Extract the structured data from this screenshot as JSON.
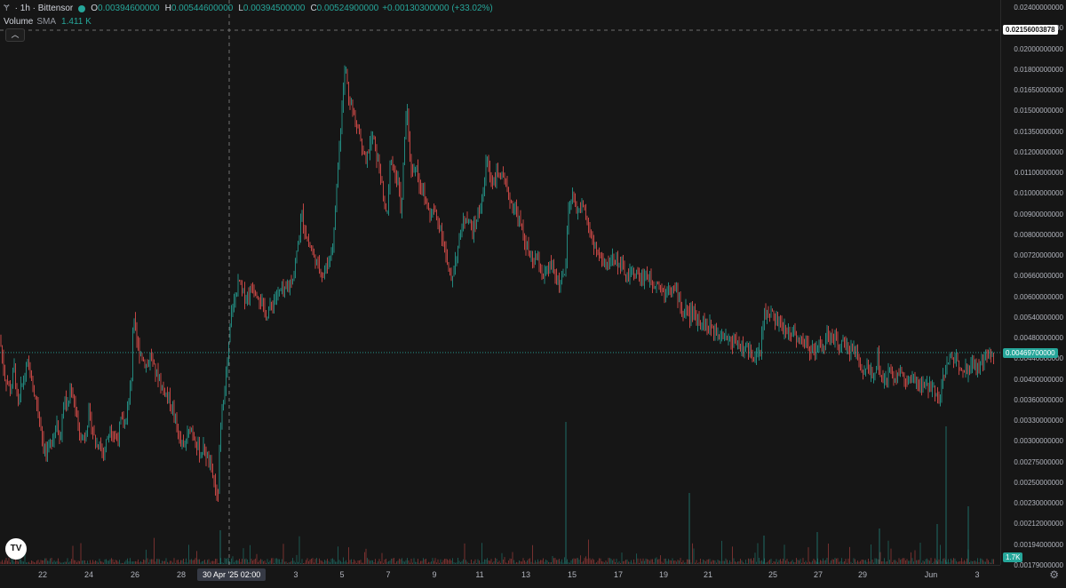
{
  "symbol": {
    "glyph": "Ɏ",
    "title": "· 1h · Bittensor",
    "ohlc": {
      "o_key": "O",
      "o": "0.00394600000",
      "h_key": "H",
      "h": "0.00544600000",
      "l_key": "L",
      "l": "0.00394500000",
      "c_key": "C",
      "c": "0.00524900000",
      "change": "+0.00130300000 (+33.02%)"
    }
  },
  "volume": {
    "label": "Volume",
    "sma_label": "SMA",
    "value": "1.411 K"
  },
  "collapse_icon": "chevron-up-icon",
  "logo_text": "TV",
  "price_axis": {
    "labels": [
      "0.02400000000",
      "0.02200000000",
      "0.02000000000",
      "0.01800000000",
      "0.01650000000",
      "0.01500000000",
      "0.01350000000",
      "0.01200000000",
      "0.01100000000",
      "0.01000000000",
      "0.00900000000",
      "0.00800000000",
      "0.00720000000",
      "0.00660000000",
      "0.00600000000",
      "0.00540000000",
      "0.00480000000",
      "0.00440000000",
      "0.00400000000",
      "0.00360000000",
      "0.00330000000",
      "0.00300000000",
      "0.00275000000",
      "0.00250000000",
      "0.00230000000",
      "0.00212000000",
      "0.00194000000",
      "0.00179000000"
    ],
    "crosshair_price": "0.02156003878",
    "last_price": "0.00469700000",
    "volume_tag": "1.7K"
  },
  "time_axis": {
    "labels": [
      "22",
      "24",
      "26",
      "28",
      "3",
      "5",
      "7",
      "9",
      "11",
      "13",
      "15",
      "17",
      "19",
      "21",
      "25",
      "27",
      "29",
      "Jun",
      "3"
    ],
    "crosshair_time": "30 Apr '25   02:00"
  },
  "colors": {
    "up": "#26a69a",
    "down": "#ef5350",
    "background": "#161616"
  },
  "chart_data": {
    "type": "candlestick",
    "y_scale": "log",
    "ylim": [
      0.00179,
      0.024
    ],
    "close_path": [
      [
        0,
        0.005
      ],
      [
        2,
        0.0047
      ],
      [
        5,
        0.0042
      ],
      [
        8,
        0.0041
      ],
      [
        12,
        0.0039
      ],
      [
        16,
        0.0044
      ],
      [
        20,
        0.0036
      ],
      [
        24,
        0.004
      ],
      [
        28,
        0.0042
      ],
      [
        32,
        0.0045
      ],
      [
        36,
        0.004
      ],
      [
        40,
        0.0038
      ],
      [
        44,
        0.0035
      ],
      [
        48,
        0.0031
      ],
      [
        52,
        0.0029
      ],
      [
        56,
        0.003
      ],
      [
        60,
        0.0032
      ],
      [
        64,
        0.0034
      ],
      [
        68,
        0.0031
      ],
      [
        72,
        0.0038
      ],
      [
        76,
        0.0036
      ],
      [
        80,
        0.004
      ],
      [
        84,
        0.0037
      ],
      [
        88,
        0.0033
      ],
      [
        92,
        0.0031
      ],
      [
        96,
        0.0032
      ],
      [
        100,
        0.0035
      ],
      [
        104,
        0.0033
      ],
      [
        108,
        0.003
      ],
      [
        112,
        0.0031
      ],
      [
        116,
        0.0029
      ],
      [
        120,
        0.0031
      ],
      [
        124,
        0.0033
      ],
      [
        128,
        0.0032
      ],
      [
        132,
        0.0031
      ],
      [
        136,
        0.0034
      ],
      [
        140,
        0.0033
      ],
      [
        144,
        0.0036
      ],
      [
        148,
        0.0042
      ],
      [
        150,
        0.0056
      ],
      [
        152,
        0.0052
      ],
      [
        154,
        0.0049
      ],
      [
        158,
        0.0047
      ],
      [
        162,
        0.0045
      ],
      [
        166,
        0.0044
      ],
      [
        170,
        0.0047
      ],
      [
        174,
        0.0043
      ],
      [
        178,
        0.0042
      ],
      [
        182,
        0.004
      ],
      [
        186,
        0.0039
      ],
      [
        190,
        0.0038
      ],
      [
        194,
        0.0036
      ],
      [
        198,
        0.0034
      ],
      [
        202,
        0.0031
      ],
      [
        206,
        0.003
      ],
      [
        210,
        0.0031
      ],
      [
        214,
        0.0033
      ],
      [
        218,
        0.0032
      ],
      [
        222,
        0.003
      ],
      [
        226,
        0.0029
      ],
      [
        230,
        0.003
      ],
      [
        234,
        0.0028
      ],
      [
        238,
        0.0027
      ],
      [
        242,
        0.0025
      ],
      [
        245,
        0.0023
      ],
      [
        247,
        0.0029
      ],
      [
        250,
        0.0036
      ],
      [
        253,
        0.004
      ],
      [
        256,
        0.0044
      ],
      [
        258,
        0.005
      ],
      [
        260,
        0.0056
      ],
      [
        263,
        0.0059
      ],
      [
        266,
        0.0062
      ],
      [
        269,
        0.0066
      ],
      [
        272,
        0.0063
      ],
      [
        276,
        0.0061
      ],
      [
        280,
        0.0062
      ],
      [
        284,
        0.0064
      ],
      [
        288,
        0.0063
      ],
      [
        292,
        0.0061
      ],
      [
        296,
        0.0058
      ],
      [
        300,
        0.0056
      ],
      [
        304,
        0.0058
      ],
      [
        308,
        0.006
      ],
      [
        312,
        0.0062
      ],
      [
        316,
        0.0063
      ],
      [
        320,
        0.0062
      ],
      [
        324,
        0.0064
      ],
      [
        328,
        0.0066
      ],
      [
        332,
        0.007
      ],
      [
        336,
        0.008
      ],
      [
        340,
        0.009
      ],
      [
        344,
        0.0082
      ],
      [
        348,
        0.0078
      ],
      [
        352,
        0.0075
      ],
      [
        356,
        0.0072
      ],
      [
        360,
        0.007
      ],
      [
        364,
        0.0068
      ],
      [
        368,
        0.0071
      ],
      [
        372,
        0.0074
      ],
      [
        376,
        0.0083
      ],
      [
        380,
        0.011
      ],
      [
        383,
        0.013
      ],
      [
        386,
        0.0165
      ],
      [
        389,
        0.018
      ],
      [
        392,
        0.016
      ],
      [
        396,
        0.015
      ],
      [
        400,
        0.014
      ],
      [
        404,
        0.0135
      ],
      [
        408,
        0.012
      ],
      [
        412,
        0.0115
      ],
      [
        416,
        0.0125
      ],
      [
        420,
        0.013
      ],
      [
        424,
        0.0118
      ],
      [
        428,
        0.011
      ],
      [
        432,
        0.0095
      ],
      [
        436,
        0.009
      ],
      [
        440,
        0.012
      ],
      [
        444,
        0.011
      ],
      [
        448,
        0.0105
      ],
      [
        452,
        0.009
      ],
      [
        456,
        0.0135
      ],
      [
        458,
        0.015
      ],
      [
        461,
        0.012
      ],
      [
        464,
        0.011
      ],
      [
        468,
        0.0115
      ],
      [
        472,
        0.0105
      ],
      [
        476,
        0.01
      ],
      [
        480,
        0.0095
      ],
      [
        484,
        0.009
      ],
      [
        488,
        0.0092
      ],
      [
        492,
        0.0088
      ],
      [
        496,
        0.0085
      ],
      [
        500,
        0.0078
      ],
      [
        504,
        0.007
      ],
      [
        508,
        0.0066
      ],
      [
        512,
        0.0072
      ],
      [
        516,
        0.0078
      ],
      [
        520,
        0.0085
      ],
      [
        524,
        0.009
      ],
      [
        528,
        0.0087
      ],
      [
        532,
        0.0083
      ],
      [
        536,
        0.0088
      ],
      [
        540,
        0.0092
      ],
      [
        544,
        0.01
      ],
      [
        548,
        0.0118
      ],
      [
        552,
        0.0108
      ],
      [
        556,
        0.0105
      ],
      [
        560,
        0.011
      ],
      [
        564,
        0.0108
      ],
      [
        568,
        0.0104
      ],
      [
        572,
        0.0099
      ],
      [
        576,
        0.0095
      ],
      [
        580,
        0.0092
      ],
      [
        584,
        0.0088
      ],
      [
        588,
        0.0083
      ],
      [
        592,
        0.0078
      ],
      [
        596,
        0.0074
      ],
      [
        600,
        0.0072
      ],
      [
        604,
        0.0073
      ],
      [
        608,
        0.007
      ],
      [
        612,
        0.0067
      ],
      [
        616,
        0.0069
      ],
      [
        620,
        0.0071
      ],
      [
        624,
        0.0068
      ],
      [
        628,
        0.0066
      ],
      [
        632,
        0.0066
      ],
      [
        636,
        0.0068
      ],
      [
        640,
        0.009
      ],
      [
        644,
        0.0098
      ],
      [
        648,
        0.0094
      ],
      [
        652,
        0.0091
      ],
      [
        656,
        0.0096
      ],
      [
        660,
        0.0088
      ],
      [
        664,
        0.0082
      ],
      [
        668,
        0.0079
      ],
      [
        672,
        0.0075
      ],
      [
        676,
        0.0073
      ],
      [
        680,
        0.0072
      ],
      [
        684,
        0.007
      ],
      [
        688,
        0.0074
      ],
      [
        692,
        0.0073
      ],
      [
        696,
        0.0072
      ],
      [
        700,
        0.007
      ],
      [
        704,
        0.0068
      ],
      [
        708,
        0.0067
      ],
      [
        712,
        0.0069
      ],
      [
        716,
        0.0068
      ],
      [
        720,
        0.0067
      ],
      [
        724,
        0.0067
      ],
      [
        728,
        0.0068
      ],
      [
        732,
        0.0066
      ],
      [
        736,
        0.0065
      ],
      [
        740,
        0.0066
      ],
      [
        744,
        0.0064
      ],
      [
        748,
        0.0062
      ],
      [
        752,
        0.0065
      ],
      [
        756,
        0.0064
      ],
      [
        760,
        0.0063
      ],
      [
        764,
        0.0061
      ],
      [
        768,
        0.0056
      ],
      [
        772,
        0.0058
      ],
      [
        776,
        0.0056
      ],
      [
        780,
        0.0057
      ],
      [
        784,
        0.0055
      ],
      [
        788,
        0.0055
      ],
      [
        792,
        0.0054
      ],
      [
        796,
        0.0053
      ],
      [
        800,
        0.0053
      ],
      [
        804,
        0.0052
      ],
      [
        808,
        0.0052
      ],
      [
        812,
        0.0052
      ],
      [
        816,
        0.0051
      ],
      [
        820,
        0.005
      ],
      [
        824,
        0.0049
      ],
      [
        828,
        0.005
      ],
      [
        832,
        0.0049
      ],
      [
        836,
        0.0048
      ],
      [
        840,
        0.0048
      ],
      [
        844,
        0.0047
      ],
      [
        848,
        0.0047
      ],
      [
        852,
        0.0046
      ],
      [
        856,
        0.0047
      ],
      [
        860,
        0.0057
      ],
      [
        864,
        0.0056
      ],
      [
        868,
        0.0057
      ],
      [
        872,
        0.0055
      ],
      [
        876,
        0.0054
      ],
      [
        880,
        0.0053
      ],
      [
        884,
        0.0052
      ],
      [
        888,
        0.0052
      ],
      [
        892,
        0.0052
      ],
      [
        896,
        0.0051
      ],
      [
        900,
        0.005
      ],
      [
        904,
        0.0049
      ],
      [
        908,
        0.0049
      ],
      [
        912,
        0.0048
      ],
      [
        916,
        0.0048
      ],
      [
        920,
        0.0048
      ],
      [
        924,
        0.0048
      ],
      [
        928,
        0.0049
      ],
      [
        932,
        0.0051
      ],
      [
        936,
        0.005
      ],
      [
        940,
        0.005
      ],
      [
        944,
        0.0049
      ],
      [
        948,
        0.0049
      ],
      [
        952,
        0.0048
      ],
      [
        956,
        0.0048
      ],
      [
        960,
        0.0048
      ],
      [
        964,
        0.0047
      ],
      [
        968,
        0.0044
      ],
      [
        972,
        0.0043
      ],
      [
        976,
        0.0044
      ],
      [
        980,
        0.0043
      ],
      [
        984,
        0.0043
      ],
      [
        988,
        0.0046
      ],
      [
        990,
        0.0041
      ],
      [
        994,
        0.0042
      ],
      [
        998,
        0.0042
      ],
      [
        1002,
        0.0043
      ],
      [
        1006,
        0.0042
      ],
      [
        1010,
        0.0042
      ],
      [
        1014,
        0.0043
      ],
      [
        1018,
        0.0041
      ],
      [
        1022,
        0.0041
      ],
      [
        1026,
        0.0041
      ],
      [
        1030,
        0.0041
      ],
      [
        1034,
        0.004
      ],
      [
        1038,
        0.004
      ],
      [
        1042,
        0.004
      ],
      [
        1046,
        0.004
      ],
      [
        1050,
        0.004
      ],
      [
        1054,
        0.0039
      ],
      [
        1058,
        0.0038
      ],
      [
        1062,
        0.0042
      ],
      [
        1066,
        0.0044
      ],
      [
        1070,
        0.0046
      ],
      [
        1074,
        0.0046
      ],
      [
        1078,
        0.0045
      ],
      [
        1082,
        0.0044
      ],
      [
        1086,
        0.0044
      ],
      [
        1090,
        0.0043
      ],
      [
        1094,
        0.0045
      ],
      [
        1098,
        0.0044
      ],
      [
        1102,
        0.0043
      ],
      [
        1106,
        0.0045
      ],
      [
        1110,
        0.0046
      ],
      [
        1114,
        0.0046
      ],
      [
        1118,
        0.0047
      ]
    ]
  }
}
